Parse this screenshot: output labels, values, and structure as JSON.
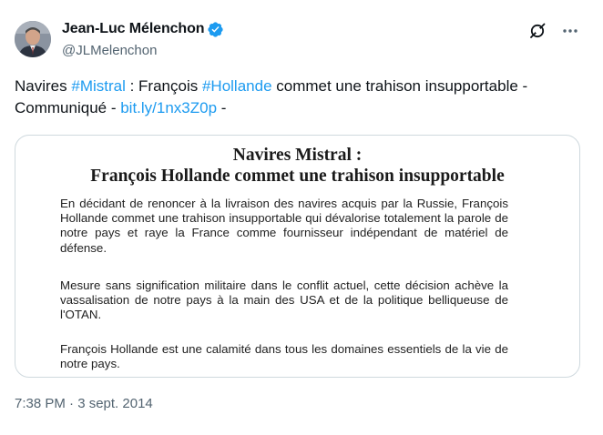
{
  "author": {
    "display_name": "Jean-Luc Mélenchon",
    "handle": "@JLMelenchon",
    "verified_icon": "verified-badge-icon",
    "verified_color": "#1d9bf0"
  },
  "actions": {
    "grok_icon": "grok-icon",
    "more_icon": "more-icon"
  },
  "tweet": {
    "parts": [
      {
        "text": "Navires ",
        "link": false
      },
      {
        "text": "#Mistral",
        "link": true
      },
      {
        "text": " : François ",
        "link": false
      },
      {
        "text": "#Hollande",
        "link": true
      },
      {
        "text": " commet une trahison insupportable - Communiqué - ",
        "link": false
      },
      {
        "text": "bit.ly/1nx3Z0p",
        "link": true
      },
      {
        "text": " -",
        "link": false
      }
    ],
    "link_color": "#1d9bf0"
  },
  "document": {
    "title_line1": "Navires Mistral :",
    "title_line2": "François Hollande commet une trahison insupportable",
    "paragraph1": "En décidant de renoncer à la livraison des navires acquis par la Russie, François Hollande commet une trahison insupportable qui dévalorise totalement la parole de notre pays et raye la France comme fournisseur indépendant de matériel de défense.",
    "paragraph2": "Mesure sans signification militaire dans le conflit actuel, cette décision achève la vassalisation de notre pays à la main des USA et de la politique belliqueuse de l'OTAN.",
    "paragraph3": "François Hollande est une calamité dans tous les domaines essentiels de la vie de notre pays."
  },
  "timestamp": "7:38 PM · 3 sept. 2014"
}
